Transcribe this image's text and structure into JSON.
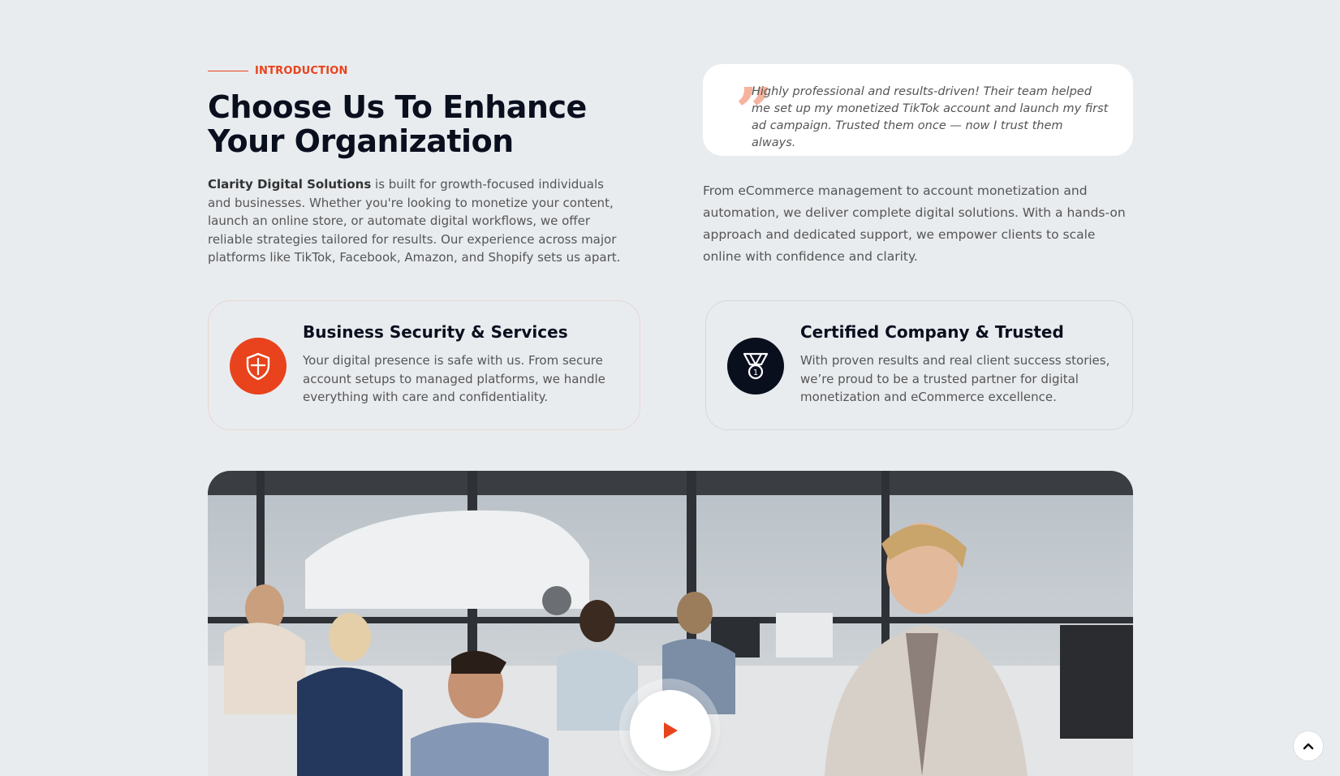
{
  "intro": {
    "tag": "INTRODUCTION",
    "heading": "Choose Us To Enhance Your Organization",
    "company_name": "Clarity Digital Solutions",
    "paragraph_rest": " is built for growth-focused individuals and businesses. Whether you're looking to monetize your content, launch an online store, or automate digital workflows, we offer reliable strategies tailored for results. Our experience across major platforms like TikTok, Facebook, Amazon, and Shopify sets us apart."
  },
  "testimonial": {
    "quote": "Highly professional and results-driven! Their team helped me set up my monetized TikTok account and launch my first ad campaign. Trusted them once — now I trust them always."
  },
  "right_paragraph": "From eCommerce management to account monetization and automation, we deliver complete digital solutions. With a hands-on approach and dedicated support, we empower clients to scale online with confidence and clarity.",
  "features": [
    {
      "icon": "shield-icon",
      "title": "Business Security & Services",
      "description": "Your digital presence is safe with us. From secure account setups to managed platforms, we handle everything with care and confidentiality."
    },
    {
      "icon": "medal-icon",
      "title": "Certified Company & Trusted",
      "description": "With proven results and real client success stories, we’re proud to be a trusted partner for digital monetization and eCommerce excellence."
    }
  ],
  "video": {
    "play_icon": "play-icon",
    "image_description_icon": "office-team-photo"
  },
  "colors": {
    "accent": "#e8431c",
    "dark": "#0a0f1e",
    "background": "#e9ecef"
  },
  "scroll_top_icon": "chevron-up-icon"
}
